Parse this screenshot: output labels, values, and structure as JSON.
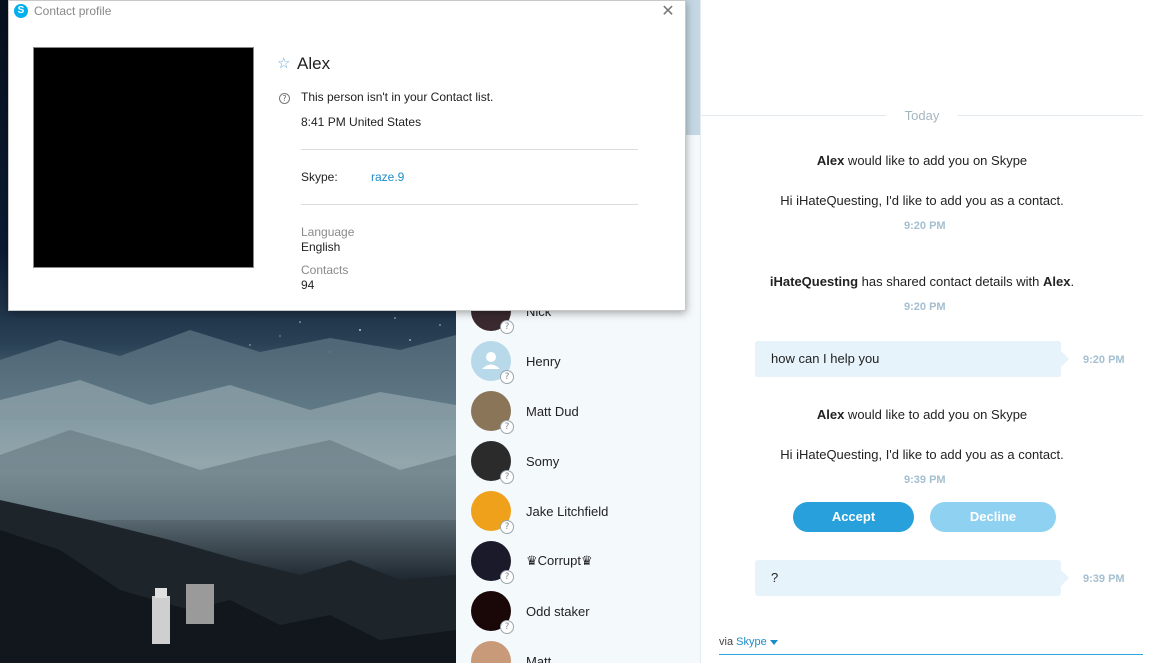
{
  "profile_dialog": {
    "title": "Contact profile",
    "app_icon_letter": "S",
    "close_glyph": "✕",
    "star_glyph": "☆",
    "name": "Alex",
    "not_in_list_note": "This person isn't in your Contact list.",
    "local_time": "8:41 PM United States",
    "skype_label": "Skype:",
    "skype_id": "raze.9",
    "language_label": "Language",
    "language_value": "English",
    "contacts_label": "Contacts",
    "contacts_value": "94"
  },
  "contact_list": {
    "status_glyph": "?",
    "items": [
      {
        "name": "Nick",
        "avatar_color": "#3a2a30"
      },
      {
        "name": "Henry",
        "avatar_color": "#b8d9ea"
      },
      {
        "name": "Matt Dud",
        "avatar_color": "#8a7558"
      },
      {
        "name": "Somy",
        "avatar_color": "#2b2b2b"
      },
      {
        "name": "Jake Litchfield",
        "avatar_color": "#f0a11c"
      },
      {
        "name": "♛Corrupt♛",
        "avatar_color": "#1a1a2a"
      },
      {
        "name": "Odd staker",
        "avatar_color": "#1a0808"
      },
      {
        "name": "Matt",
        "avatar_color": "#c89a7a"
      }
    ]
  },
  "chat": {
    "date_separator": "Today",
    "events": {
      "add_request_1": {
        "bold_name": "Alex",
        "text": " would like to add you on Skype"
      },
      "add_message_1": "Hi iHateQuesting, I'd like to add you as a contact.",
      "time_1": "9:20 PM",
      "shared": {
        "sender": "iHateQuesting",
        "middle": " has shared contact details with ",
        "recipient": "Alex",
        "end": "."
      },
      "time_2": "9:20 PM",
      "bubble_1": {
        "text": "how can I help you",
        "time": "9:20 PM"
      },
      "add_request_2": {
        "bold_name": "Alex",
        "text": " would like to add you on Skype"
      },
      "add_message_2": "Hi iHateQuesting, I'd like to add you as a contact.",
      "time_3": "9:39 PM",
      "bubble_2": {
        "text": "?",
        "time": "9:39 PM"
      }
    },
    "accept_label": "Accept",
    "decline_label": "Decline",
    "via_prefix": "via",
    "via_link": "Skype",
    "colors": {
      "accent": "#27a0dc",
      "accent_light": "#8fd1f0",
      "bubble": "#e6f3fb"
    }
  }
}
